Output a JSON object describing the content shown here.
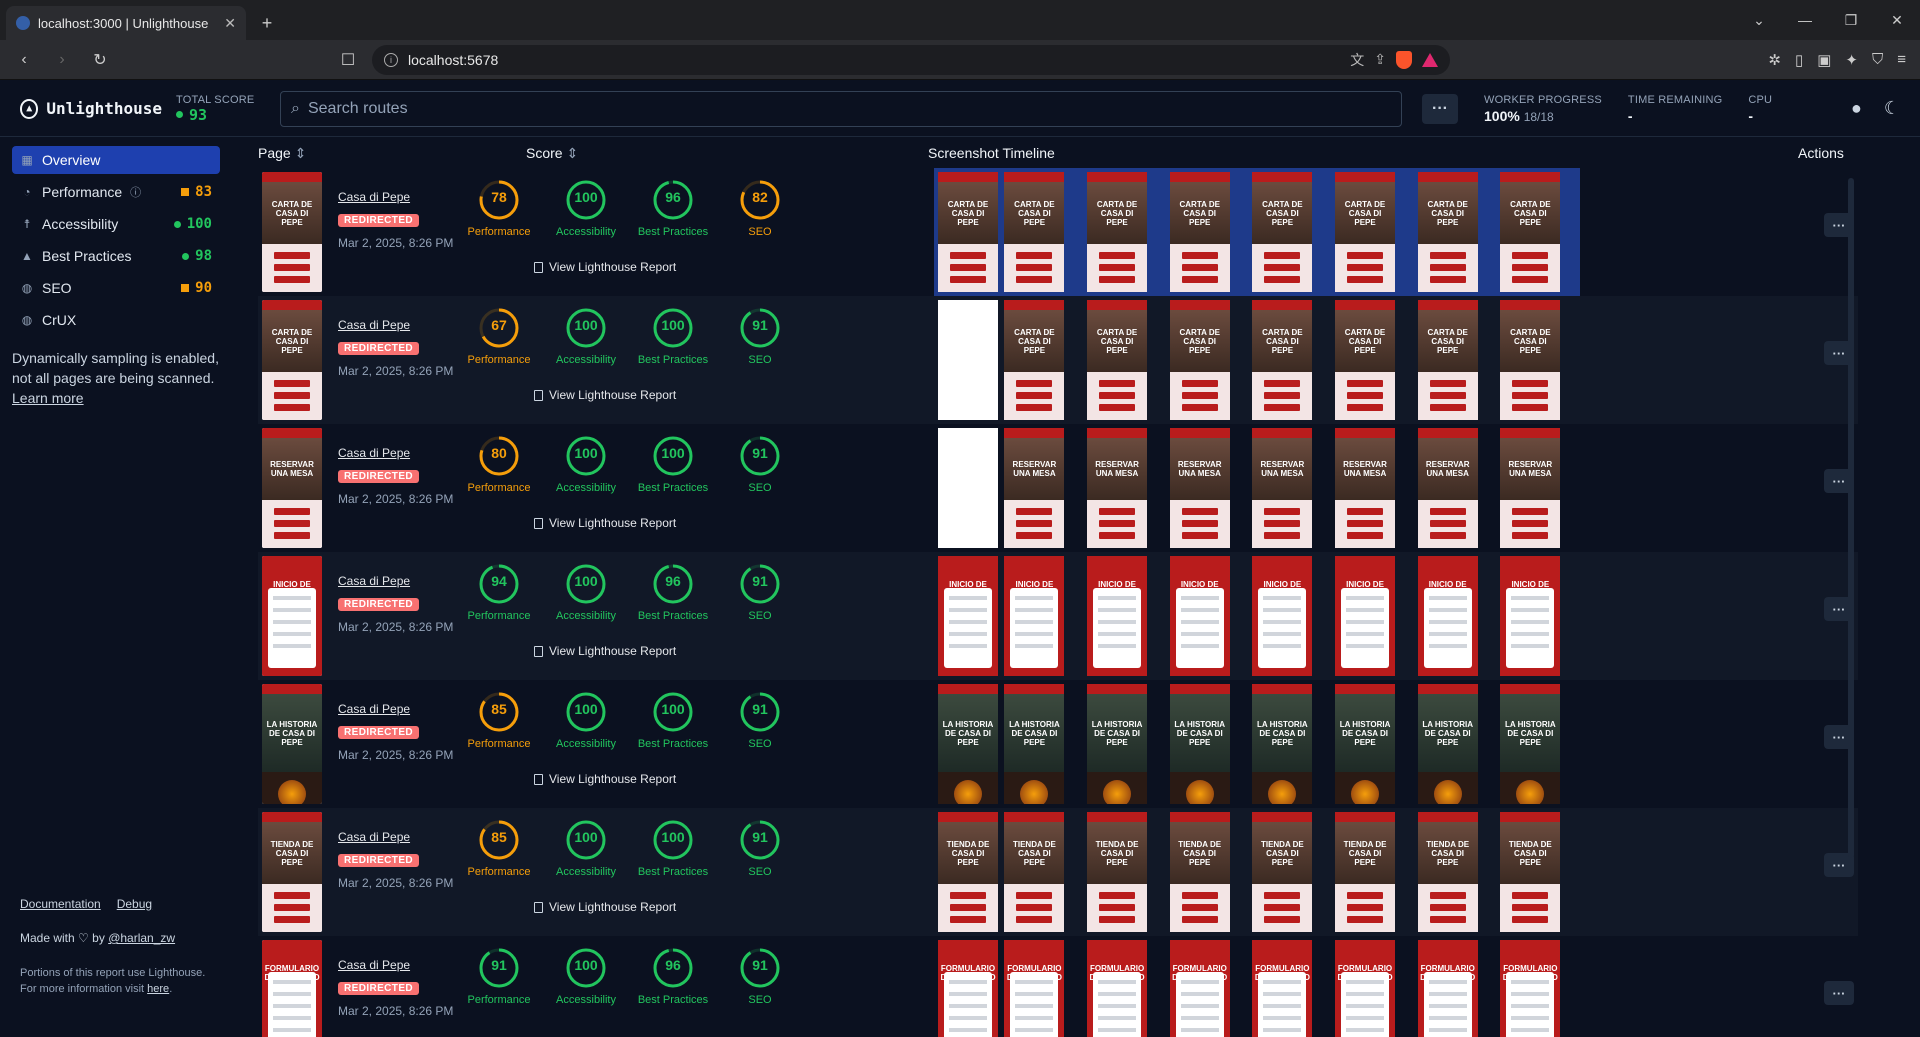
{
  "browser": {
    "tab_title": "localhost:3000 | Unlighthouse",
    "url": "localhost:5678"
  },
  "app": {
    "name": "Unlighthouse",
    "total_score_label": "TOTAL SCORE",
    "total_score": "93",
    "search_placeholder": "Search routes",
    "worker_progress_label": "WORKER PROGRESS",
    "worker_progress": "100%",
    "worker_count": "18/18",
    "time_remaining_label": "TIME REMAINING",
    "time_remaining": "-",
    "cpu_label": "CPU",
    "cpu": "-"
  },
  "sidebar": {
    "items": [
      {
        "label": "Overview",
        "score": "",
        "icon": "grid-icon"
      },
      {
        "label": "Performance",
        "score": "83",
        "icon": "gauge-icon"
      },
      {
        "label": "Accessibility",
        "score": "100",
        "icon": "person-icon"
      },
      {
        "label": "Best Practices",
        "score": "98",
        "icon": "thumbs-up-icon"
      },
      {
        "label": "SEO",
        "score": "90",
        "icon": "globe-icon"
      },
      {
        "label": "CrUX",
        "score": "",
        "icon": "globe-icon"
      }
    ],
    "sampling_text": "Dynamically sampling is enabled, not all pages are being scanned.",
    "learn_more": "Learn more",
    "documentation": "Documentation",
    "debug": "Debug",
    "made_with": "Made with",
    "by": "by",
    "author": "@harlan_zw",
    "portions": "Portions of this report use Lighthouse. For more information visit",
    "here": "here",
    "period": "."
  },
  "table": {
    "headers": {
      "page": "Page",
      "score": "Score",
      "timeline": "Screenshot Timeline",
      "actions": "Actions"
    },
    "view_report": "View Lighthouse Report",
    "labels": [
      "Performance",
      "Accessibility",
      "Best Practices",
      "SEO"
    ],
    "rows": [
      {
        "page": "Casa di Pepe",
        "badge": "REDIRECTED",
        "date": "Mar 2, 2025, 8:26 PM",
        "scores": [
          78,
          100,
          96,
          82
        ],
        "shot": "CARTA DE CASA DI PEPE",
        "kind": "hero"
      },
      {
        "page": "Casa di Pepe",
        "badge": "REDIRECTED",
        "date": "Mar 2, 2025, 8:26 PM",
        "scores": [
          67,
          100,
          100,
          91
        ],
        "shot": "CARTA DE CASA DI PEPE",
        "kind": "hero"
      },
      {
        "page": "Casa di Pepe",
        "badge": "REDIRECTED",
        "date": "Mar 2, 2025, 8:26 PM",
        "scores": [
          80,
          100,
          100,
          91
        ],
        "shot": "RESERVAR UNA MESA",
        "kind": "hero"
      },
      {
        "page": "Casa di Pepe",
        "badge": "REDIRECTED",
        "date": "Mar 2, 2025, 8:26 PM",
        "scores": [
          94,
          100,
          96,
          91
        ],
        "shot": "INICIO DE SESIÓN",
        "kind": "red"
      },
      {
        "page": "Casa di Pepe",
        "badge": "REDIRECTED",
        "date": "Mar 2, 2025, 8:26 PM",
        "scores": [
          85,
          100,
          100,
          91
        ],
        "shot": "LA HISTORIA DE CASA DI PEPE",
        "kind": "dark"
      },
      {
        "page": "Casa di Pepe",
        "badge": "REDIRECTED",
        "date": "Mar 2, 2025, 8:26 PM",
        "scores": [
          85,
          100,
          100,
          91
        ],
        "shot": "TIENDA DE CASA DI PEPE",
        "kind": "hero"
      },
      {
        "page": "Casa di Pepe",
        "badge": "REDIRECTED",
        "date": "Mar 2, 2025, 8:26 PM",
        "scores": [
          91,
          100,
          96,
          91
        ],
        "shot": "FORMULARIO DE REGISTRO",
        "kind": "red"
      }
    ]
  },
  "colors": {
    "good": "#22c55e",
    "average": "#f59e0b",
    "accent": "#1e40af"
  }
}
